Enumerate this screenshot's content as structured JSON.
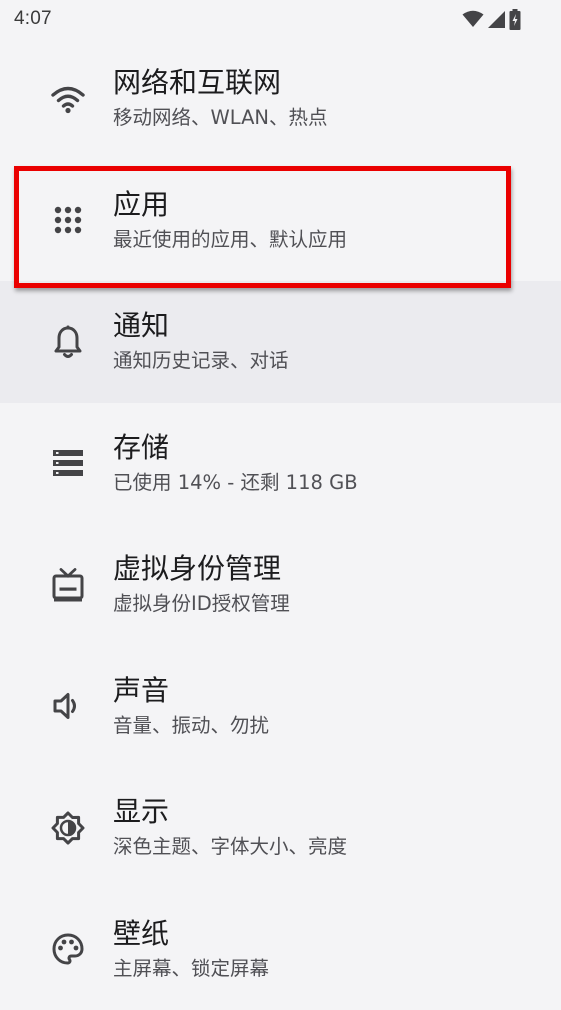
{
  "status_bar": {
    "time": "4:07",
    "icons": [
      "wifi-icon",
      "cell-signal-icon",
      "battery-charging-icon"
    ]
  },
  "settings": {
    "items": [
      {
        "id": "network",
        "title": "网络和互联网",
        "subtitle": "移动网络、WLAN、热点",
        "icon": "wifi-icon"
      },
      {
        "id": "apps",
        "title": "应用",
        "subtitle": "最近使用的应用、默认应用",
        "icon": "apps-grid-icon"
      },
      {
        "id": "notifications",
        "title": "通知",
        "subtitle": "通知历史记录、对话",
        "icon": "bell-icon"
      },
      {
        "id": "storage",
        "title": "存储",
        "subtitle": "已使用 14% - 还剩 118 GB",
        "icon": "storage-icon"
      },
      {
        "id": "virtual-identity",
        "title": "虚拟身份管理",
        "subtitle": "虚拟身份ID授权管理",
        "icon": "tv-icon"
      },
      {
        "id": "sound",
        "title": "声音",
        "subtitle": "音量、振动、勿扰",
        "icon": "volume-icon"
      },
      {
        "id": "display",
        "title": "显示",
        "subtitle": "深色主题、字体大小、亮度",
        "icon": "brightness-icon"
      },
      {
        "id": "wallpaper",
        "title": "壁纸",
        "subtitle": "主屏幕、锁定屏幕",
        "icon": "palette-icon"
      }
    ]
  },
  "colors": {
    "background": "#f4f4f6",
    "selected_row": "#ebebef",
    "highlight_border": "#ea0000",
    "icon": "#444447"
  }
}
